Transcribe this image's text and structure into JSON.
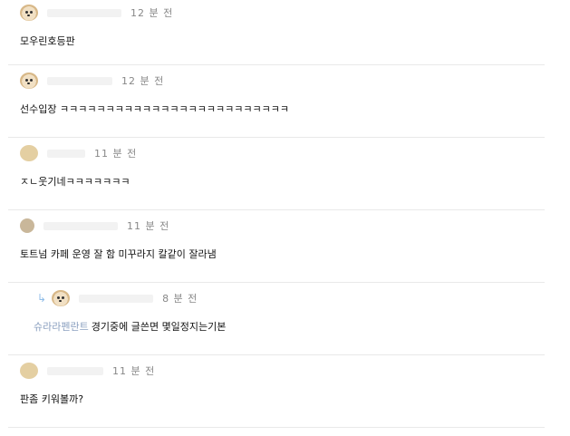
{
  "comments": [
    {
      "time": "12 분 전",
      "text": "모우린호등판"
    },
    {
      "time": "12 분 전",
      "text": "선수입장 ㅋㅋㅋㅋㅋㅋㅋㅋㅋㅋㅋㅋㅋㅋㅋㅋㅋㅋㅋㅋㅋㅋㅋㅋㅋ"
    },
    {
      "time": "11 분 전",
      "text": "ㅈㄴ웃기네ㅋㅋㅋㅋㅋㅋㅋ"
    },
    {
      "time": "11 분 전",
      "text": "토트넘 카페 운영 잘 함 미꾸라지 칼같이 잘라냄"
    },
    {
      "time": "8 분 전",
      "mention": "슈라라펜란트",
      "text": "경기중에 글쓴면 몇일정지는기본"
    },
    {
      "time": "11 분 전",
      "text": "판좀 키워볼까?"
    }
  ],
  "icons": {
    "avatar": "dog-avatar-icon",
    "reply": "reply-arrow-icon"
  },
  "colors": {
    "mention": "#8a9fbf",
    "reply_arrow": "#8fbde8",
    "divider": "#e9e9e9"
  }
}
